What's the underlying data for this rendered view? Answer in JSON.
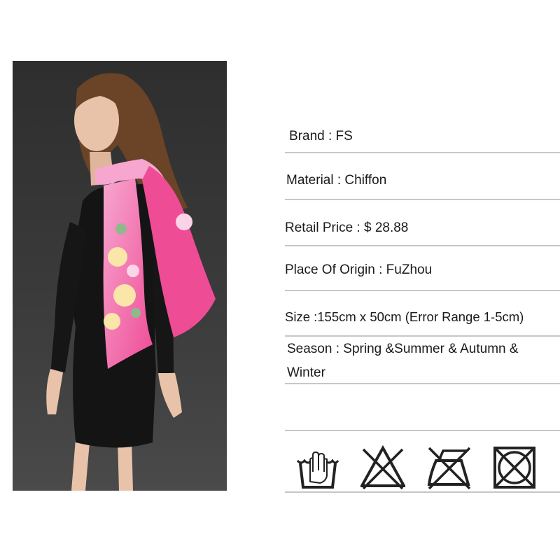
{
  "product_photo": {
    "description": "model-wearing-pink-floral-chiffon-scarf",
    "colors": {
      "background": "#3a3a3a",
      "dress": "#141414",
      "scarf": "#f0569c",
      "scarf_light": "#f7a6d0",
      "flowers": "#f9e6a8",
      "skin": "#e8c3aa",
      "hair": "#6b4428"
    }
  },
  "specs": {
    "brand": "Brand : FS",
    "material": "Material :  Chiffon",
    "retail_price": "Retail Price : $ 28.88",
    "origin": "Place Of Origin : FuZhou",
    "size": "Size :155cm x 50cm (Error Range 1-5cm)",
    "season_line1": "Season : Spring &Summer & Autumn &",
    "season_line2": "Winter"
  },
  "care_icons": [
    "hand-wash-icon",
    "do-not-bleach-icon",
    "do-not-iron-icon",
    "do-not-tumble-dry-icon"
  ],
  "style": {
    "divider_color": "#c7c7c7",
    "icon_color": "#222222"
  }
}
